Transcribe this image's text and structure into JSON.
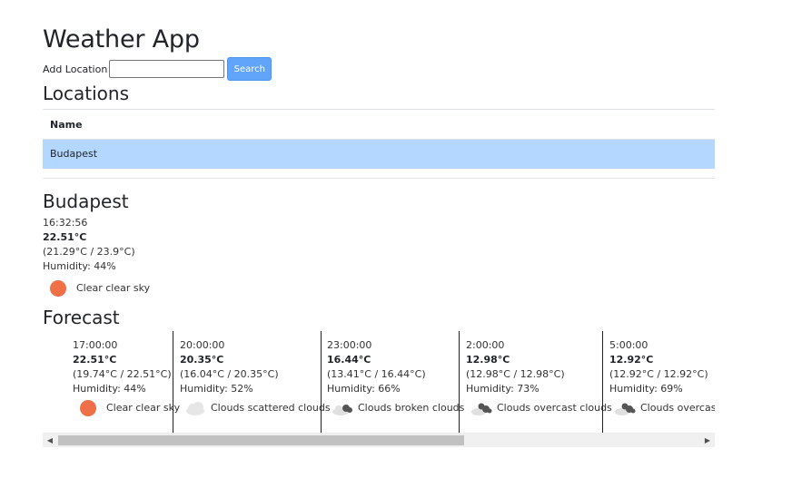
{
  "app": {
    "title": "Weather App"
  },
  "search": {
    "label": "Add Location",
    "value": "",
    "placeholder": "",
    "button_label": "Search"
  },
  "locations": {
    "heading": "Locations",
    "column_name": "Name",
    "rows": [
      {
        "name": "Budapest",
        "selected": true
      }
    ]
  },
  "current": {
    "city": "Budapest",
    "time": "16:32:56",
    "temperature": "22.51°C",
    "range": "(21.29°C / 23.9°C)",
    "humidity": "Humidity: 44%",
    "condition": "Clear clear sky",
    "icon": "sun-icon"
  },
  "forecast": {
    "heading": "Forecast",
    "items": [
      {
        "time": "17:00:00",
        "temperature": "22.51°C",
        "range": "(19.74°C / 22.51°C)",
        "humidity": "Humidity: 44%",
        "condition": "Clear clear sky",
        "icon": "sun-icon"
      },
      {
        "time": "20:00:00",
        "temperature": "20.35°C",
        "range": "(16.04°C / 20.35°C)",
        "humidity": "Humidity: 52%",
        "condition": "Clouds scattered clouds",
        "icon": "scattered-clouds-icon"
      },
      {
        "time": "23:00:00",
        "temperature": "16.44°C",
        "range": "(13.41°C / 16.44°C)",
        "humidity": "Humidity: 66%",
        "condition": "Clouds broken clouds",
        "icon": "broken-clouds-icon"
      },
      {
        "time": "2:00:00",
        "temperature": "12.98°C",
        "range": "(12.98°C / 12.98°C)",
        "humidity": "Humidity: 73%",
        "condition": "Clouds overcast clouds",
        "icon": "overcast-clouds-icon"
      },
      {
        "time": "5:00:00",
        "temperature": "12.92°C",
        "range": "(12.92°C / 12.92°C)",
        "humidity": "Humidity: 69%",
        "condition": "Clouds overcast clouds",
        "icon": "overcast-clouds-icon"
      }
    ]
  },
  "colors": {
    "accent": "#60a5fa",
    "selected_row": "#b3d7ff",
    "sun": "#ef6f48"
  }
}
